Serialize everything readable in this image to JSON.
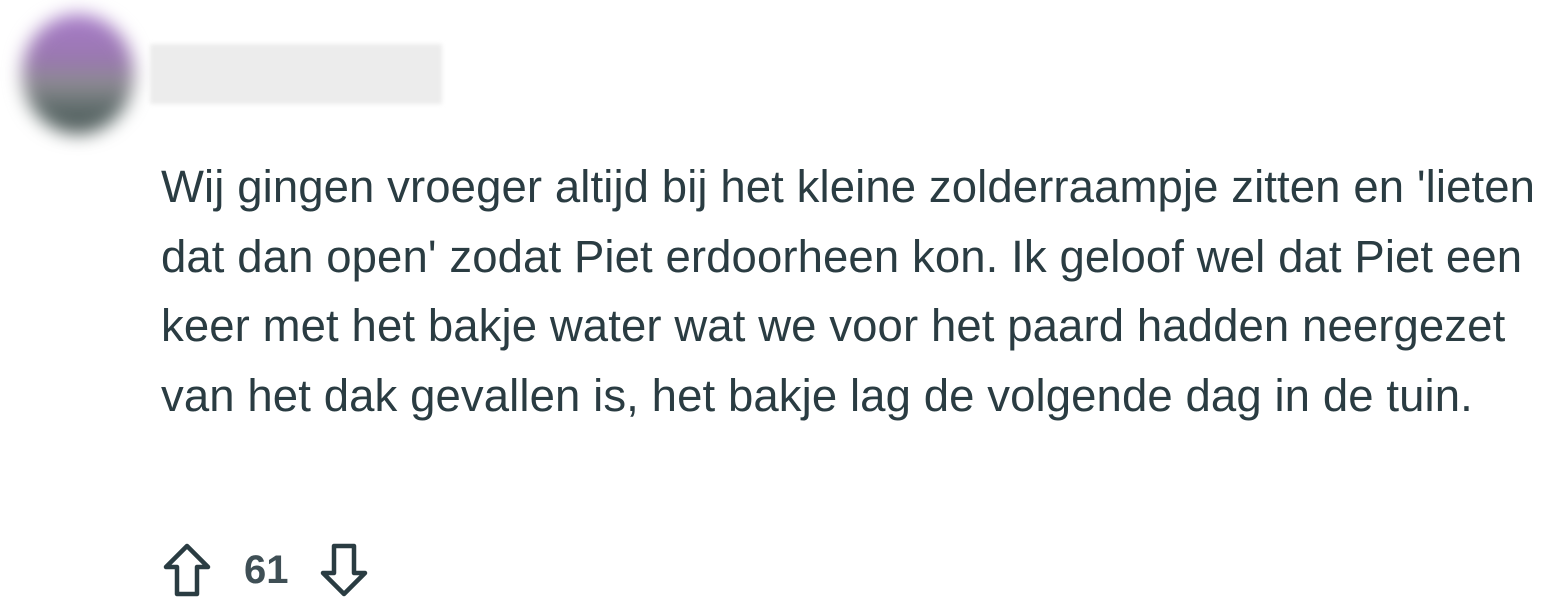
{
  "comment": {
    "author": "",
    "body": "Wij gingen vroeger altijd bij het kleine zolderraampje zitten en 'lieten dat dan open' zodat Piet erdoorheen kon. Ik geloof wel dat Piet een keer met het bakje water wat we voor het paard hadden neergezet van het dak gevallen is, het bakje lag de volgende dag in de tuin.",
    "score": "61"
  },
  "icons": {
    "upvote": "arrow-up-outline-icon",
    "downvote": "arrow-down-outline-icon"
  },
  "colors": {
    "text": "#2a3c42",
    "icon": "#2a3c42",
    "background": "#ffffff"
  }
}
